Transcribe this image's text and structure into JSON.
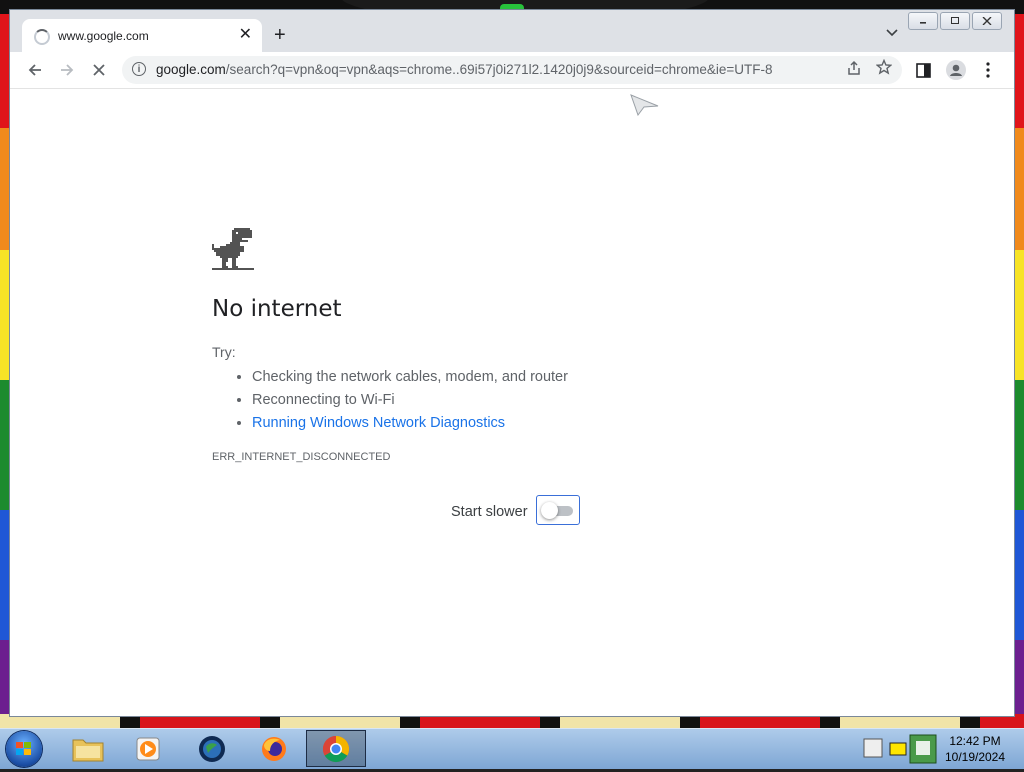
{
  "tab": {
    "title": "www.google.com",
    "close": "✕"
  },
  "new_tab": "+",
  "omnibox": {
    "host": "google.com",
    "path": "/search?q=vpn&oq=vpn&aqs=chrome..69i57j0i271l2.1420j0j9&sourceid=chrome&ie=UTF-8"
  },
  "error_page": {
    "title": "No internet",
    "try_label": "Try:",
    "suggestions": [
      "Checking the network cables, modem, and router",
      "Reconnecting to Wi-Fi"
    ],
    "link_suggestion": "Running Windows Network Diagnostics",
    "error_code": "ERR_INTERNET_DISCONNECTED",
    "toggle_label": "Start slower",
    "toggle_on": false
  },
  "taskbar": {
    "apps": [
      "windows-explorer",
      "media-player",
      "globe",
      "firefox",
      "chrome"
    ],
    "active_app": "chrome"
  },
  "clock": {
    "time": "12:42 PM",
    "date": "10/19/2024"
  },
  "icons": {
    "back": "arrow-left-icon",
    "forward": "arrow-right-icon",
    "stop": "stop-loading-icon",
    "share": "share-icon",
    "bookmark": "star-icon",
    "side_panel": "side-panel-icon",
    "profile": "profile-icon",
    "menu": "kebab-menu-icon"
  },
  "colors": {
    "link": "#1a73e8",
    "toggle_border": "#3a6fd8"
  }
}
